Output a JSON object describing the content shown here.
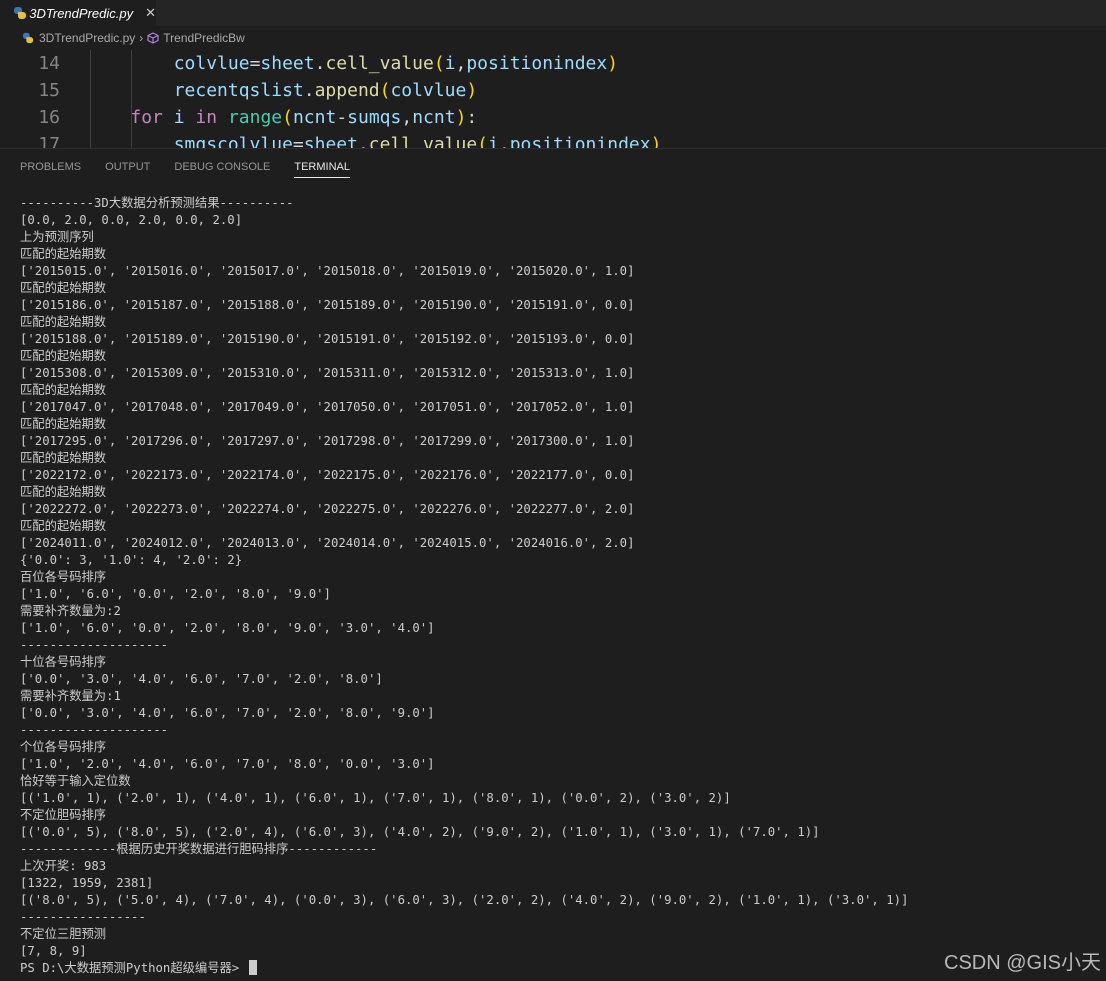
{
  "tab": {
    "title": "3DTrendPredic.py",
    "close": "✕"
  },
  "breadcrumb": {
    "file": "3DTrendPredic.py",
    "symbol": "TrendPredicBw"
  },
  "editor": {
    "lines": [
      {
        "num": "14",
        "tokens": [
          [
            "        ",
            "t-op"
          ],
          [
            "colvlue",
            "t-var"
          ],
          [
            "=",
            "t-op"
          ],
          [
            "sheet",
            "t-var"
          ],
          [
            ".",
            "t-op"
          ],
          [
            "cell_value",
            "t-fn"
          ],
          [
            "(",
            "t-p1"
          ],
          [
            "i",
            "t-var"
          ],
          [
            ",",
            "t-op"
          ],
          [
            "positionindex",
            "t-var"
          ],
          [
            ")",
            "t-p1"
          ]
        ]
      },
      {
        "num": "15",
        "tokens": [
          [
            "        ",
            "t-op"
          ],
          [
            "recentqslist",
            "t-var"
          ],
          [
            ".",
            "t-op"
          ],
          [
            "append",
            "t-fn"
          ],
          [
            "(",
            "t-p1"
          ],
          [
            "colvlue",
            "t-var"
          ],
          [
            ")",
            "t-p1"
          ]
        ]
      },
      {
        "num": "16",
        "tokens": [
          [
            "    ",
            "t-op"
          ],
          [
            "for",
            "t-kw"
          ],
          [
            " ",
            "t-op"
          ],
          [
            "i",
            "t-var"
          ],
          [
            " ",
            "t-op"
          ],
          [
            "in",
            "t-kw"
          ],
          [
            " ",
            "t-op"
          ],
          [
            "range",
            "t-builtin"
          ],
          [
            "(",
            "t-p1"
          ],
          [
            "ncnt",
            "t-var"
          ],
          [
            "-",
            "t-op"
          ],
          [
            "sumqs",
            "t-var"
          ],
          [
            ",",
            "t-op"
          ],
          [
            "ncnt",
            "t-var"
          ],
          [
            ")",
            "t-p1"
          ],
          [
            ":",
            "t-op"
          ]
        ]
      },
      {
        "num": "17",
        "tokens": [
          [
            "        ",
            "t-op"
          ],
          [
            "smqscolvlue",
            "t-var"
          ],
          [
            "=",
            "t-op"
          ],
          [
            "sheet",
            "t-var"
          ],
          [
            ".",
            "t-op"
          ],
          [
            "cell_value",
            "t-fn"
          ],
          [
            "(",
            "t-p1"
          ],
          [
            "i",
            "t-var"
          ],
          [
            ",",
            "t-op"
          ],
          [
            "positionindex",
            "t-var"
          ],
          [
            ")",
            "t-p1"
          ]
        ]
      }
    ]
  },
  "panel": {
    "tabs": [
      {
        "label": "PROBLEMS",
        "active": false
      },
      {
        "label": "OUTPUT",
        "active": false
      },
      {
        "label": "DEBUG CONSOLE",
        "active": false
      },
      {
        "label": "TERMINAL",
        "active": true
      }
    ]
  },
  "terminal": {
    "lines": [
      "----------3D大数据分析预测结果----------",
      "[0.0, 2.0, 0.0, 2.0, 0.0, 2.0]",
      "上为预测序列",
      "匹配的起始期数",
      "['2015015.0', '2015016.0', '2015017.0', '2015018.0', '2015019.0', '2015020.0', 1.0]",
      "匹配的起始期数",
      "['2015186.0', '2015187.0', '2015188.0', '2015189.0', '2015190.0', '2015191.0', 0.0]",
      "匹配的起始期数",
      "['2015188.0', '2015189.0', '2015190.0', '2015191.0', '2015192.0', '2015193.0', 0.0]",
      "匹配的起始期数",
      "['2015308.0', '2015309.0', '2015310.0', '2015311.0', '2015312.0', '2015313.0', 1.0]",
      "匹配的起始期数",
      "['2017047.0', '2017048.0', '2017049.0', '2017050.0', '2017051.0', '2017052.0', 1.0]",
      "匹配的起始期数",
      "['2017295.0', '2017296.0', '2017297.0', '2017298.0', '2017299.0', '2017300.0', 1.0]",
      "匹配的起始期数",
      "['2022172.0', '2022173.0', '2022174.0', '2022175.0', '2022176.0', '2022177.0', 0.0]",
      "匹配的起始期数",
      "['2022272.0', '2022273.0', '2022274.0', '2022275.0', '2022276.0', '2022277.0', 2.0]",
      "匹配的起始期数",
      "['2024011.0', '2024012.0', '2024013.0', '2024014.0', '2024015.0', '2024016.0', 2.0]",
      "{'0.0': 3, '1.0': 4, '2.0': 2}",
      "百位各号码排序",
      "['1.0', '6.0', '0.0', '2.0', '8.0', '9.0']",
      "需要补齐数量为:2",
      "['1.0', '6.0', '0.0', '2.0', '8.0', '9.0', '3.0', '4.0']",
      "--------------------",
      "十位各号码排序",
      "['0.0', '3.0', '4.0', '6.0', '7.0', '2.0', '8.0']",
      "需要补齐数量为:1",
      "['0.0', '3.0', '4.0', '6.0', '7.0', '2.0', '8.0', '9.0']",
      "--------------------",
      "个位各号码排序",
      "['1.0', '2.0', '4.0', '6.0', '7.0', '8.0', '0.0', '3.0']",
      "恰好等于输入定位数",
      "[('1.0', 1), ('2.0', 1), ('4.0', 1), ('6.0', 1), ('7.0', 1), ('8.0', 1), ('0.0', 2), ('3.0', 2)]",
      "不定位胆码排序",
      "[('0.0', 5), ('8.0', 5), ('2.0', 4), ('6.0', 3), ('4.0', 2), ('9.0', 2), ('1.0', 1), ('3.0', 1), ('7.0', 1)]",
      "-------------根据历史开奖数据进行胆码排序------------",
      "上次开奖: 983",
      "[1322, 1959, 2381]",
      "[('8.0', 5), ('5.0', 4), ('7.0', 4), ('0.0', 3), ('6.0', 3), ('2.0', 2), ('4.0', 2), ('9.0', 2), ('1.0', 1), ('3.0', 1)]",
      "-----------------",
      "不定位三胆预测",
      "[7, 8, 9]"
    ],
    "prompt": "PS D:\\大数据预测Python超级编号器> "
  },
  "watermark": "CSDN @GIS小天"
}
